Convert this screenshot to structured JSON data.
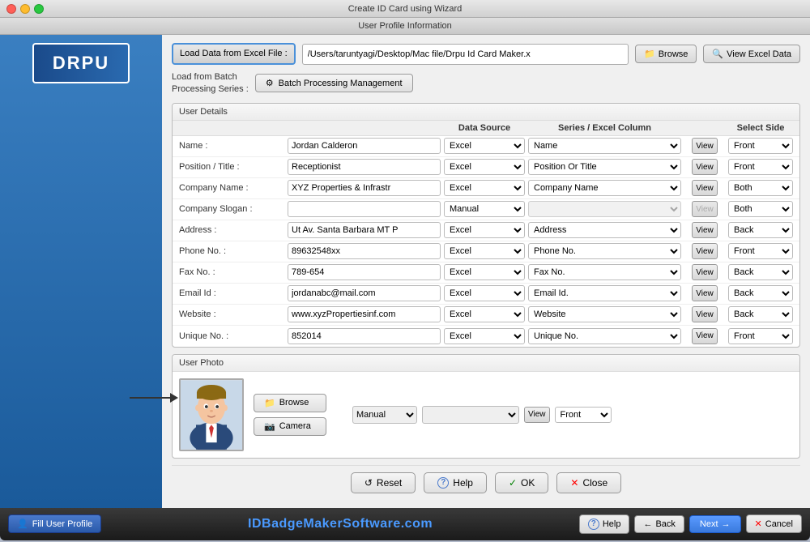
{
  "window": {
    "title": "Create ID Card using Wizard",
    "subtitle": "User Profile Information"
  },
  "toolbar": {
    "load_data_label": "Load Data from\nExcel File :",
    "file_path": "/Users/taruntyagi/Desktop/Mac file/Drpu Id Card Maker.x",
    "browse_label": "Browse",
    "view_excel_label": "View Excel Data",
    "batch_label": "Load from Batch\nProcessing Series :",
    "batch_btn_label": "Batch Processing Management"
  },
  "user_details": {
    "section_title": "User Details",
    "headers": {
      "col1": "",
      "col2": "",
      "data_source": "Data Source",
      "series_excel": "Series / Excel Column",
      "col5": "",
      "select_side": "Select Side"
    },
    "rows": [
      {
        "label": "Name :",
        "value": "Jordan Calderon",
        "data_source": "Excel",
        "series": "Name",
        "view_enabled": true,
        "side": "Front"
      },
      {
        "label": "Position / Title :",
        "value": "Receptionist",
        "data_source": "Excel",
        "series": "Position Or Title",
        "view_enabled": true,
        "side": "Front"
      },
      {
        "label": "Company Name :",
        "value": "XYZ Properties & Infrastr",
        "data_source": "Excel",
        "series": "Company Name",
        "view_enabled": true,
        "side": "Both"
      },
      {
        "label": "Company Slogan :",
        "value": "",
        "data_source": "Manual",
        "series": "",
        "view_enabled": false,
        "side": "Both"
      },
      {
        "label": "Address :",
        "value": "Ut Av. Santa Barbara MT P",
        "data_source": "Excel",
        "series": "Address",
        "view_enabled": true,
        "side": "Back"
      },
      {
        "label": "Phone No. :",
        "value": "89632548xx",
        "data_source": "Excel",
        "series": "Phone No.",
        "view_enabled": true,
        "side": "Front"
      },
      {
        "label": "Fax No. :",
        "value": "789-654",
        "data_source": "Excel",
        "series": "Fax No.",
        "view_enabled": true,
        "side": "Back"
      },
      {
        "label": "Email Id :",
        "value": "jordanabc@mail.com",
        "data_source": "Excel",
        "series": "Email Id.",
        "view_enabled": true,
        "side": "Back"
      },
      {
        "label": "Website :",
        "value": "www.xyzPropertiesinf.com",
        "data_source": "Excel",
        "series": "Website",
        "view_enabled": true,
        "side": "Back"
      },
      {
        "label": "Unique No. :",
        "value": "852014",
        "data_source": "Excel",
        "series": "Unique No.",
        "view_enabled": true,
        "side": "Front"
      }
    ]
  },
  "user_photo": {
    "section_title": "User Photo",
    "browse_label": "Browse",
    "camera_label": "Camera",
    "data_source": "Manual",
    "series": "",
    "side": "Front"
  },
  "bottom_buttons": {
    "reset": "Reset",
    "help": "Help",
    "ok": "OK",
    "close": "Close"
  },
  "footer": {
    "fill_profile": "Fill User Profile",
    "logo_text": "IDBadgeMakerSoftware",
    "logo_tld": ".com",
    "help": "Help",
    "back": "Back",
    "next": "Next",
    "cancel": "Cancel"
  },
  "data_source_options": [
    "Excel",
    "Manual"
  ],
  "side_options": [
    "Front",
    "Back",
    "Both"
  ],
  "icons": {
    "browse": "📁",
    "view_excel": "🔍",
    "gear": "⚙",
    "refresh": "↺",
    "question": "?",
    "check": "✓",
    "close_x": "✕",
    "arrow_left": "←",
    "arrow_right": "→",
    "camera": "📷"
  }
}
